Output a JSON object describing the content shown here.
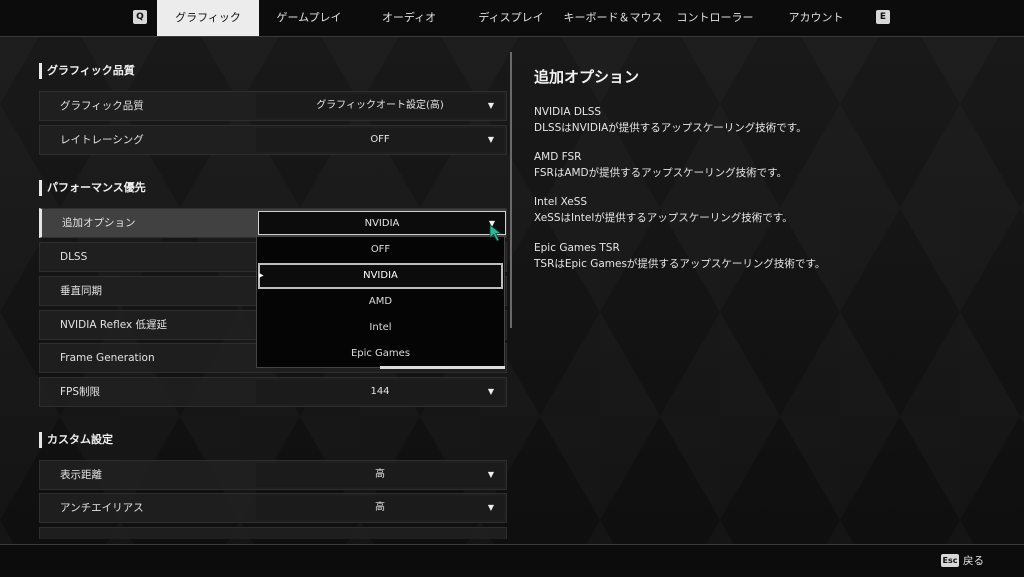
{
  "tabs": {
    "prev_key": "Q",
    "next_key": "E",
    "items": [
      "グラフィック",
      "ゲームプレイ",
      "オーディオ",
      "ディスプレイ",
      "キーボード＆マウス",
      "コントローラー",
      "アカウント"
    ]
  },
  "sections": {
    "quality": {
      "title": "グラフィック品質",
      "rows": [
        {
          "label": "グラフィック品質",
          "value": "グラフィックオート設定(高)"
        },
        {
          "label": "レイトレーシング",
          "value": "OFF"
        }
      ]
    },
    "performance": {
      "title": "パフォーマンス優先",
      "rows": [
        {
          "label": "追加オプション",
          "value": "NVIDIA"
        },
        {
          "label": "DLSS",
          "value": ""
        },
        {
          "label": "垂直同期",
          "value": ""
        },
        {
          "label": "NVIDIA Reflex 低遅延",
          "value": ""
        },
        {
          "label": "Frame Generation",
          "value": ""
        },
        {
          "label": "FPS制限",
          "value": "144"
        }
      ]
    },
    "custom": {
      "title": "カスタム設定",
      "rows": [
        {
          "label": "表示距離",
          "value": "高"
        },
        {
          "label": "アンチエイリアス",
          "value": "高"
        }
      ]
    }
  },
  "dropdown": {
    "options": [
      "OFF",
      "NVIDIA",
      "AMD",
      "Intel",
      "Epic Games"
    ],
    "selected": "NVIDIA"
  },
  "info": {
    "title": "追加オプション",
    "items": [
      {
        "name": "NVIDIA DLSS",
        "desc": "DLSSはNVIDIAが提供するアップスケーリング技術です。"
      },
      {
        "name": "AMD FSR",
        "desc": "FSRはAMDが提供するアップスケーリング技術です。"
      },
      {
        "name": "Intel XeSS",
        "desc": "XeSSはIntelが提供するアップスケーリング技術です。"
      },
      {
        "name": "Epic Games TSR",
        "desc": "TSRはEpic Gamesが提供するアップスケーリング技術です。"
      }
    ]
  },
  "footer": {
    "esc_key": "Esc",
    "back_label": "戻る"
  },
  "icons": {
    "caret": "caret-down-icon",
    "pointer": "mouse-cursor-icon"
  },
  "colors": {
    "cursor": "#2bb89a",
    "active_tab_bg": "#ececec"
  }
}
